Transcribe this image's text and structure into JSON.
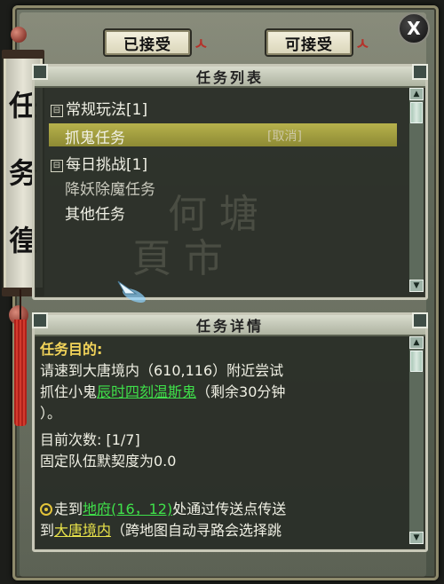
{
  "window": {
    "title_chars": [
      "任",
      "务",
      "徨"
    ]
  },
  "tabs": [
    {
      "label": "已接受"
    },
    {
      "label": "可接受"
    }
  ],
  "close_label": "X",
  "task_list": {
    "header": "任务列表",
    "groups": [
      {
        "toggle": "⊟",
        "label": "常规玩法[1]",
        "items": [
          {
            "label": "抓鬼任务",
            "action": "[取消]",
            "selected": true
          }
        ]
      },
      {
        "toggle": "⊟",
        "label": "每日挑战[1]",
        "items": [
          {
            "label": "降妖除魔任务"
          },
          {
            "label": "其他任务"
          }
        ]
      }
    ]
  },
  "task_detail": {
    "header": "任务详情",
    "goal_title": "任务目的:",
    "line1": "请速到大唐境内（610,116）附近尝试",
    "line2_prefix": "抓住小鬼",
    "line2_link": "辰时四刻温斯鬼",
    "line2_suffix": "（剩余30分钟",
    "line3": "）。",
    "count_label": "目前次数: [1/7]",
    "team_label": "固定队伍默契度为0.0",
    "route_prefix": "走到",
    "route_link": "地府(16，12)",
    "route_suffix": "处通过传送点传送",
    "route2_prefix": "到",
    "route2_link": "大唐境内",
    "route2_suffix": "（跨地图自动寻路会选择跳"
  },
  "colors": {
    "link_green": "#3fe04a",
    "link_yellow": "#e8e24a",
    "title_gold": "#f3d45a",
    "selection": "#b7b24c"
  }
}
